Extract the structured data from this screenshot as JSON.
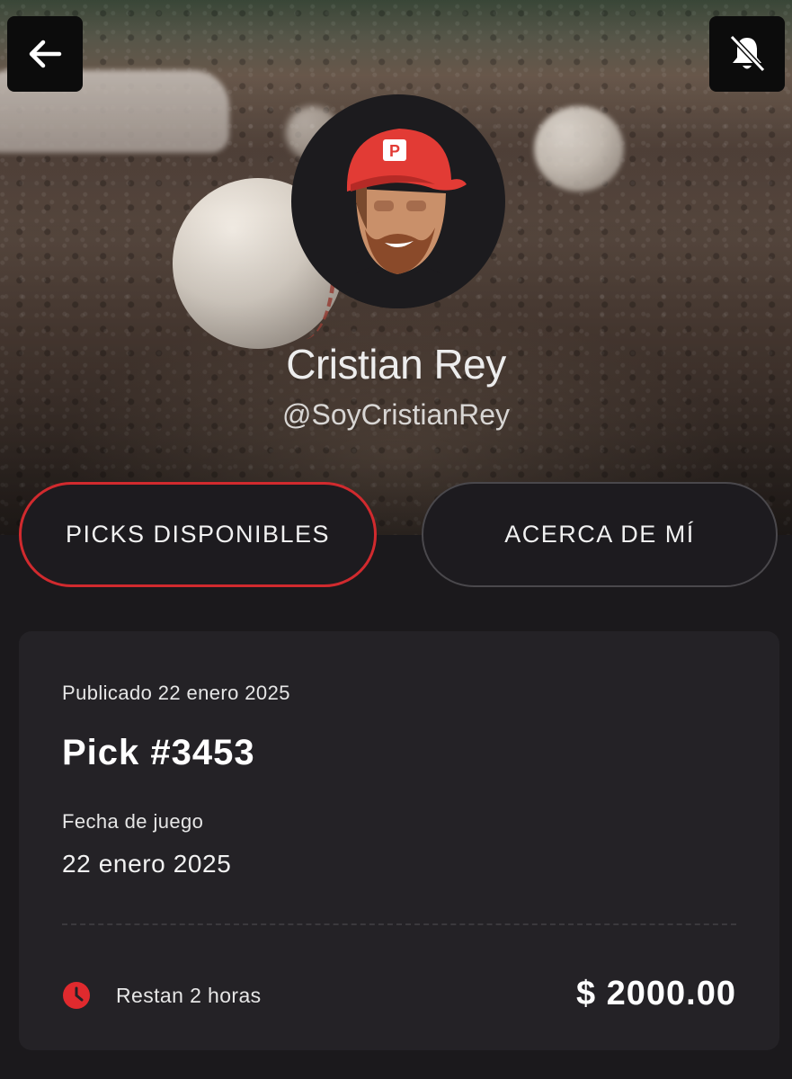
{
  "header": {
    "back_icon": "arrow-left-icon",
    "notifications_icon": "bell-off-icon"
  },
  "profile": {
    "name": "Cristian Rey",
    "handle": "@SoyCristianRey",
    "avatar_icon": "cartoon-avatar-red-cap"
  },
  "tabs": [
    {
      "label": "PICKS DISPONIBLES",
      "active": true
    },
    {
      "label": "ACERCA DE MÍ",
      "active": false
    }
  ],
  "pick": {
    "published": "Publicado 22 enero 2025",
    "title": "Pick #3453",
    "game_date_label": "Fecha de juego",
    "game_date": "22 enero 2025",
    "time_left": "Restan 2 horas",
    "price": "$ 2000.00"
  },
  "colors": {
    "accent": "#d12a2e",
    "background": "#1b191c",
    "card": "#242226"
  }
}
